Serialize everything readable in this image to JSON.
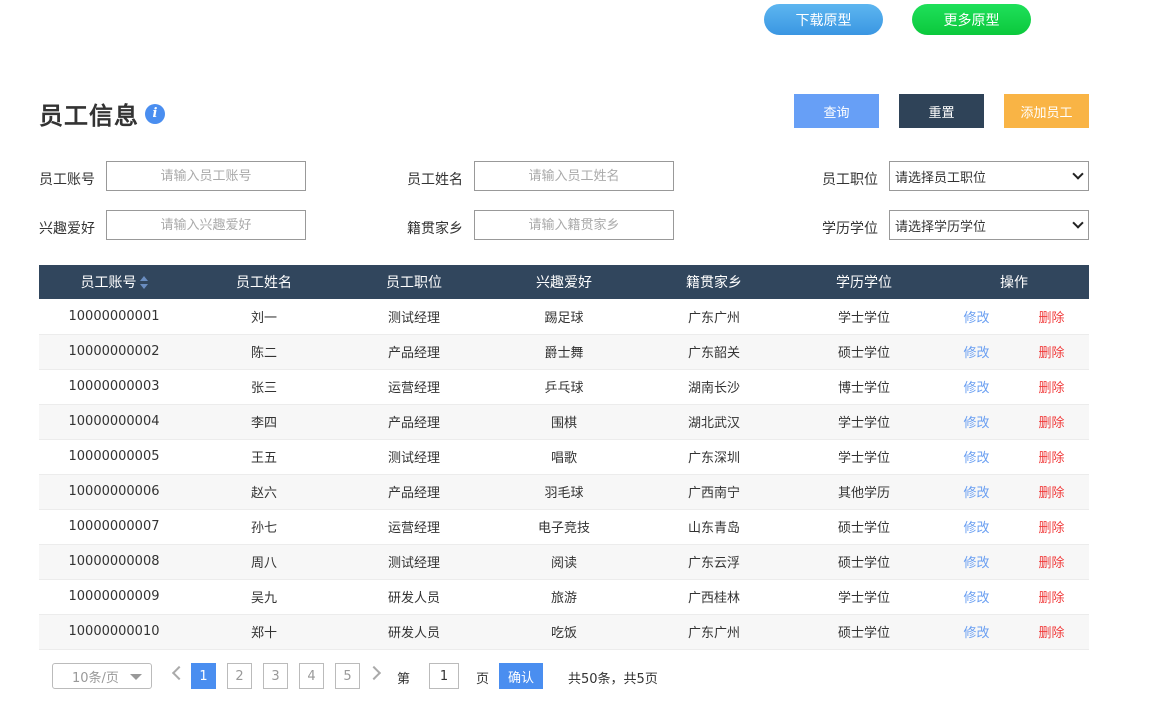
{
  "top_buttons": {
    "download": "下载原型",
    "more": "更多原型"
  },
  "page": {
    "title": "员工信息",
    "info_icon": "i"
  },
  "actions": {
    "query": "查询",
    "reset": "重置",
    "add": "添加员工"
  },
  "filters": {
    "account": {
      "label": "员工账号",
      "placeholder": "请输入员工账号"
    },
    "name": {
      "label": "员工姓名",
      "placeholder": "请输入员工姓名"
    },
    "position": {
      "label": "员工职位",
      "selected": "请选择员工职位"
    },
    "hobby": {
      "label": "兴趣爱好",
      "placeholder": "请输入兴趣爱好"
    },
    "hometown": {
      "label": "籍贯家乡",
      "placeholder": "请输入籍贯家乡"
    },
    "degree": {
      "label": "学历学位",
      "selected": "请选择学历学位"
    }
  },
  "table": {
    "headers": [
      "员工账号",
      "员工姓名",
      "员工职位",
      "兴趣爱好",
      "籍贯家乡",
      "学历学位",
      "操作"
    ],
    "edit_label": "修改",
    "delete_label": "删除",
    "rows": [
      [
        "10000000001",
        "刘一",
        "测试经理",
        "踢足球",
        "广东广州",
        "学士学位"
      ],
      [
        "10000000002",
        "陈二",
        "产品经理",
        "爵士舞",
        "广东韶关",
        "硕士学位"
      ],
      [
        "10000000003",
        "张三",
        "运营经理",
        "乒乓球",
        "湖南长沙",
        "博士学位"
      ],
      [
        "10000000004",
        "李四",
        "产品经理",
        "围棋",
        "湖北武汉",
        "学士学位"
      ],
      [
        "10000000005",
        "王五",
        "测试经理",
        "唱歌",
        "广东深圳",
        "学士学位"
      ],
      [
        "10000000006",
        "赵六",
        "产品经理",
        "羽毛球",
        "广西南宁",
        "其他学历"
      ],
      [
        "10000000007",
        "孙七",
        "运营经理",
        "电子竞技",
        "山东青岛",
        "硕士学位"
      ],
      [
        "10000000008",
        "周八",
        "测试经理",
        "阅读",
        "广东云浮",
        "硕士学位"
      ],
      [
        "10000000009",
        "吴九",
        "研发人员",
        "旅游",
        "广西桂林",
        "学士学位"
      ],
      [
        "10000000010",
        "郑十",
        "研发人员",
        "吃饭",
        "广东广州",
        "硕士学位"
      ]
    ]
  },
  "pagination": {
    "page_size": "10条/页",
    "pages": [
      "1",
      "2",
      "3",
      "4",
      "5"
    ],
    "current": "1",
    "goto_prefix": "第",
    "goto_value": "1",
    "goto_suffix": "页",
    "confirm": "确认",
    "summary": "共50条，共5页"
  },
  "colors": {
    "header_bg": "#31465d",
    "primary": "#4a8ef0",
    "query_btn": "#679ff6",
    "reset_btn": "#2f4358",
    "add_btn": "#f9b445",
    "delete_text": "#f13b3b"
  }
}
